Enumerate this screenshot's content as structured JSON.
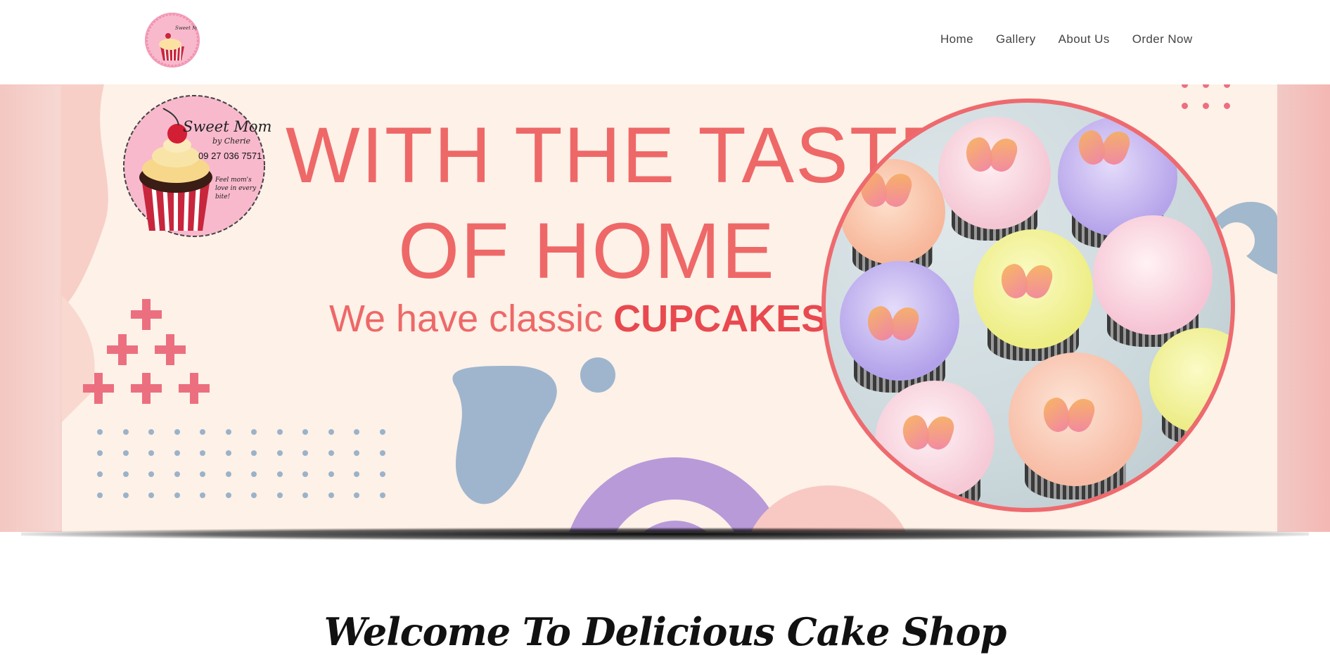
{
  "header": {
    "logo_alt": "Sweet Mom logo",
    "nav": [
      {
        "label": "Home"
      },
      {
        "label": "Gallery"
      },
      {
        "label": "About Us"
      },
      {
        "label": "Order Now"
      }
    ]
  },
  "hero": {
    "line1": "WITH THE TASTE",
    "line2": "OF HOME",
    "tagline_prefix": "We have classic ",
    "tagline_strong": "CUPCAKES",
    "badge": {
      "brand": "Sweet Mom",
      "by": "by Cherie",
      "phone": "09 27 036 7571",
      "motto": "Feel mom's love in every bite!"
    }
  },
  "welcome": {
    "title": "Welcome To Delicious Cake Shop"
  },
  "colors": {
    "accent": "#ee6868",
    "banner_bg": "#fdf1e8",
    "cross_pink": "#ec6f7f",
    "dot_blue": "#9bb2c9",
    "lavender": "#b89ad8"
  }
}
